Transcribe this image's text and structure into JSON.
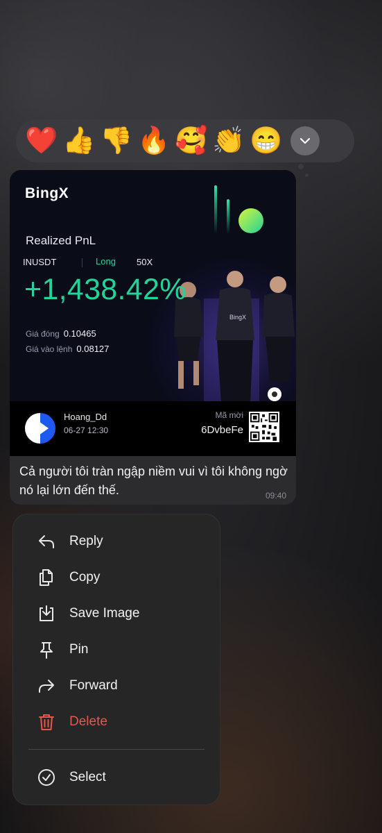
{
  "reactions": {
    "items": [
      "❤️",
      "👍",
      "👎",
      "🔥",
      "🥰",
      "👏",
      "😁"
    ],
    "more_icon": "chevron-down-icon"
  },
  "card": {
    "brand": "BingX",
    "title": "Realized PnL",
    "pair": "INUSDT",
    "side": "Long",
    "leverage": "50X",
    "pnl_percent": "+1,438.42%",
    "close_price_label": "Giá đóng",
    "close_price": "0.10465",
    "entry_price_label": "Giá vào lệnh",
    "entry_price": "0.08127",
    "username": "Hoang_Dd",
    "datetime": "06-27  12:30",
    "referral_label": "Mã mời",
    "referral_code": "6DvbeFe",
    "accent_color": "#22d49a"
  },
  "message": {
    "text": "Cả người tôi tràn ngập niềm vui vì tôi không ngờ nó lại lớn đến thế.",
    "time": "09:40"
  },
  "menu": {
    "items": [
      {
        "label": "Reply",
        "icon": "reply-icon"
      },
      {
        "label": "Copy",
        "icon": "copy-icon"
      },
      {
        "label": "Save Image",
        "icon": "save-image-icon"
      },
      {
        "label": "Pin",
        "icon": "pin-icon"
      },
      {
        "label": "Forward",
        "icon": "forward-icon"
      },
      {
        "label": "Delete",
        "icon": "trash-icon"
      },
      {
        "label": "Select",
        "icon": "check-circle-icon"
      }
    ],
    "danger_color": "#e8574b"
  }
}
